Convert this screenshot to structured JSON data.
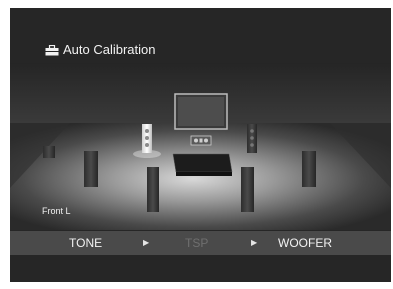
{
  "header": {
    "title": "Auto Calibration",
    "icon": "toolbox-icon"
  },
  "scene": {
    "current_speaker_label": "Front L",
    "highlighted_speaker": "front-left"
  },
  "steps": [
    {
      "label": "TONE",
      "state": "active"
    },
    {
      "label": "TSP",
      "state": "disabled"
    },
    {
      "label": "WOOFER",
      "state": "active"
    }
  ],
  "colors": {
    "background": "#262626",
    "step_bar": "#4a4a4a",
    "text": "#f2f2f2",
    "disabled_text": "#6f6f6f"
  }
}
